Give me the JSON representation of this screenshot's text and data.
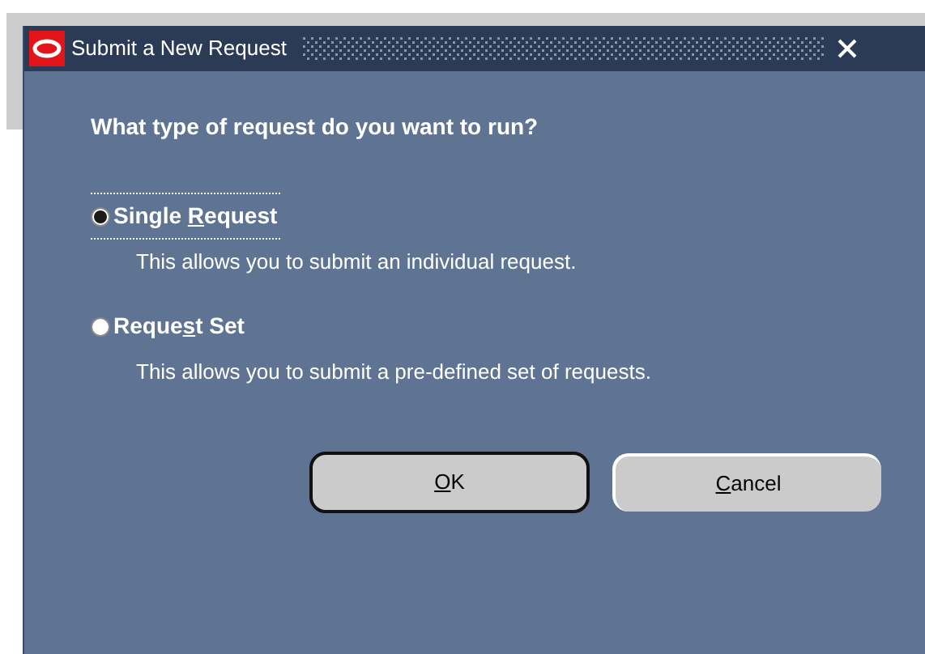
{
  "window": {
    "title": "Submit a New Request"
  },
  "question": "What type of request do you want to run?",
  "options": [
    {
      "label": {
        "before": "Single ",
        "key": "R",
        "after": "equest"
      },
      "description": "This allows you to submit an individual request.",
      "selected": true,
      "focused": true
    },
    {
      "label": {
        "before": "Reque",
        "key": "s",
        "after": "t Set"
      },
      "description": "This allows you to submit a pre-defined set of requests.",
      "selected": false,
      "focused": false
    }
  ],
  "buttons": [
    {
      "label": {
        "key": "O",
        "after": "K"
      },
      "default": true
    },
    {
      "label": {
        "key": "C",
        "after": "ancel"
      },
      "default": false
    }
  ]
}
